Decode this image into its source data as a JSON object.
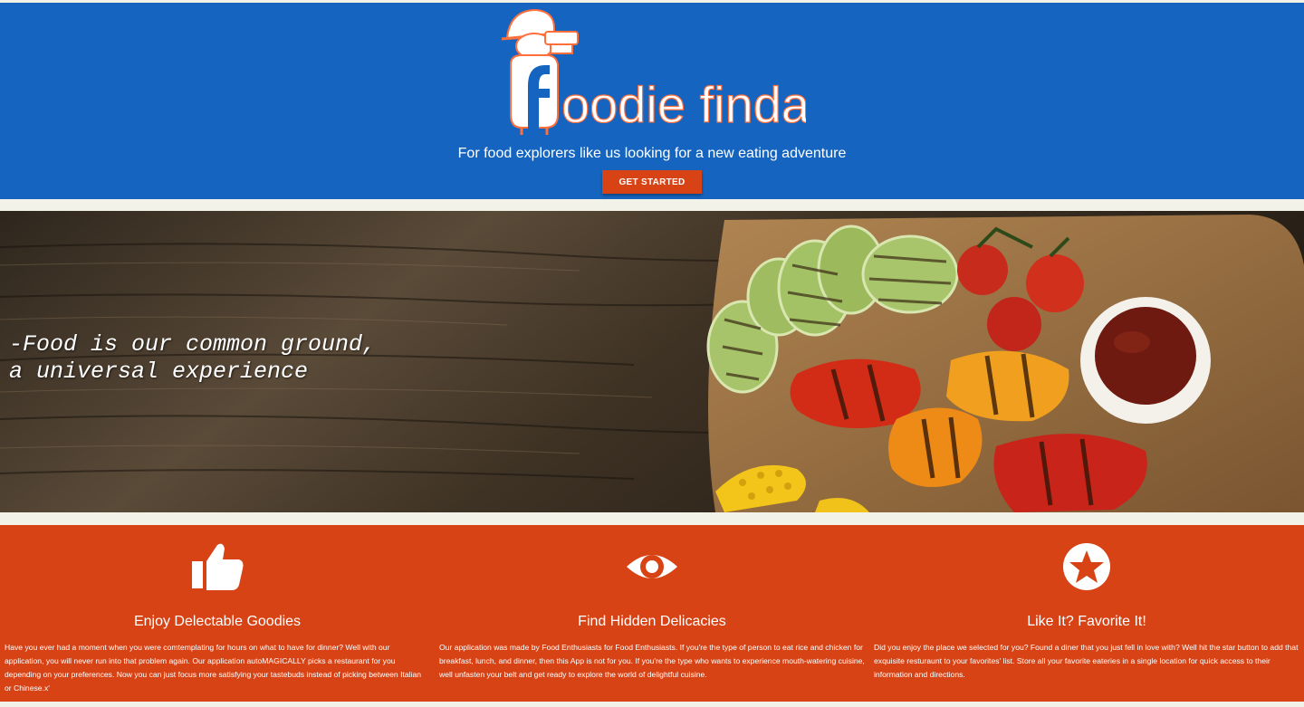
{
  "header": {
    "logo_text": "oodie finda",
    "logo_letter": "f",
    "tagline": "For food explorers like us looking for a new eating adventure",
    "cta_label": "GET STARTED"
  },
  "hero": {
    "quote_line1": "-Food is our common ground,",
    "quote_line2": "a universal experience"
  },
  "features": [
    {
      "icon": "thumbs-up-icon",
      "title": "Enjoy Delectable Goodies",
      "text": "Have you ever had a moment when you were comtemplating for hours on what to have for dinner? Well with our application, you will never run into that problem again. Our application autoMAGICALLY picks a restaurant for you depending on your preferences. Now you can just focus more satisfying your tastebuds instead of picking between Italian or Chinese.x'"
    },
    {
      "icon": "eye-icon",
      "title": "Find Hidden Delicacies",
      "text": "Our application was made by Food Enthusiasts for Food Enthusiasts. If you're the type of person to eat rice and chicken for breakfast, lunch, and dinner, then this App is not for you. If you're the type who wants to experience mouth-watering cuisine, well unfasten your belt and get ready to explore the world of delightful cuisine."
    },
    {
      "icon": "star-icon",
      "title": "Like It? Favorite It!",
      "text": "Did you enjoy the place we selected for you? Found a diner that you just fell in love with? Well hit the star button to add that exquisite resturaunt to your favorites' list. Store all your favorite eateries in a single location for quick access to their information and directions."
    }
  ],
  "colors": {
    "header_blue": "#1565c0",
    "accent_orange": "#d84315",
    "page_bg": "#f3f2e9"
  }
}
